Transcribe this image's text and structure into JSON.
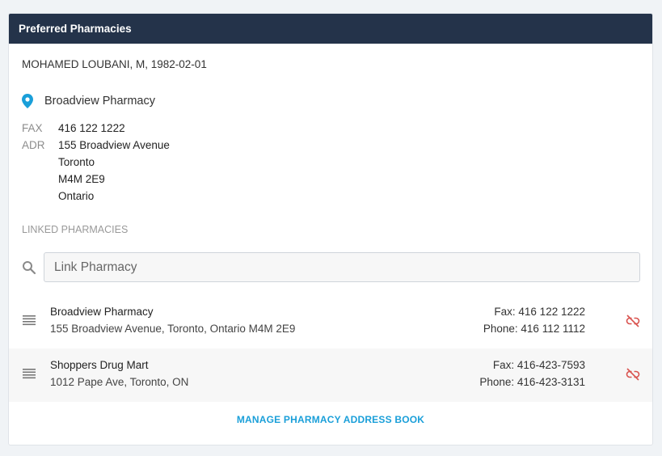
{
  "panel": {
    "title": "Preferred Pharmacies"
  },
  "patient": {
    "label": "MOHAMED LOUBANI, M, 1982-02-01"
  },
  "preferred": {
    "name": "Broadview Pharmacy",
    "fax_label": "FAX",
    "fax": "416 122 1222",
    "adr_label": "ADR",
    "address_lines": [
      "155 Broadview Avenue",
      "Toronto",
      "M4M 2E9",
      "Ontario"
    ]
  },
  "linked": {
    "title": "LINKED PHARMACIES",
    "search_placeholder": "Link Pharmacy",
    "items": [
      {
        "name": "Broadview Pharmacy",
        "address": "155 Broadview Avenue, Toronto, Ontario M4M 2E9",
        "fax": "Fax: 416 122 1222",
        "phone": "Phone: 416 112 1112"
      },
      {
        "name": "Shoppers Drug Mart",
        "address": "1012 Pape Ave, Toronto, ON",
        "fax": "Fax: 416-423-7593",
        "phone": "Phone: 416-423-3131"
      }
    ]
  },
  "manage_link": "MANAGE PHARMACY ADDRESS BOOK",
  "colors": {
    "header_bg": "#24334a",
    "accent": "#1a9fd9",
    "pin": "#1a9fd9",
    "unlink": "#d9534f"
  },
  "icons": [
    "location-pin-icon",
    "search-icon",
    "drag-handle-icon",
    "unlink-icon"
  ]
}
